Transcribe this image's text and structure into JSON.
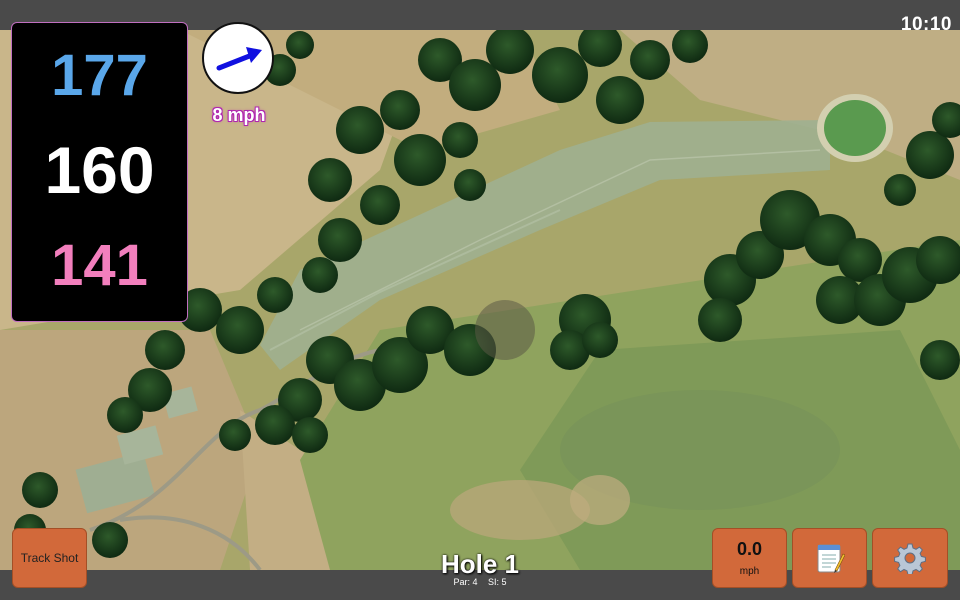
{
  "status_bar": {
    "time": "10:10"
  },
  "distances": {
    "back": "177",
    "middle": "160",
    "front": "141"
  },
  "wind": {
    "speed": "8 mph",
    "direction_icon": "arrow-east-northeast-icon"
  },
  "buttons": {
    "track_shot": "Track Shot",
    "speed_value": "0.0",
    "speed_unit": "mph",
    "notes_icon": "notepad-icon",
    "settings_icon": "gear-icon"
  },
  "hole": {
    "title": "Hole 1",
    "par": "Par: 4",
    "stroke_index": "SI: 5"
  },
  "colors": {
    "back": "#5aa7ea",
    "middle": "#ffffff",
    "front": "#f27fbd",
    "button": "#d2693a",
    "wind_arrow": "#1010e0"
  }
}
